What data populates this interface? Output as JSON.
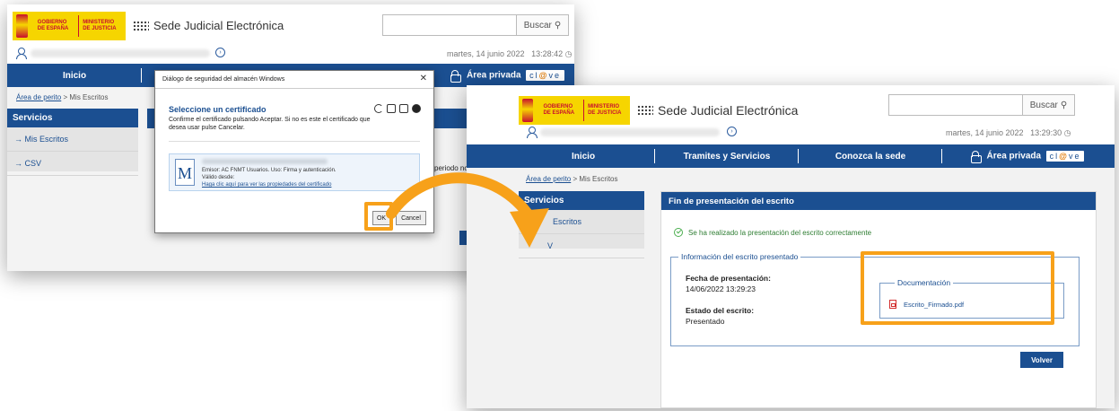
{
  "colors": {
    "brand_blue": "#1b4f91",
    "highlight_orange": "#f7a11a",
    "success_green": "#2e7d32",
    "pdf_red": "#d32f2f"
  },
  "left": {
    "header": {
      "gov_label": "GOBIERNO DE ESPAÑA",
      "ministry_label": "MINISTERIO DE JUSTICIA",
      "site_title": "Sede Judicial Electrónica",
      "search_button": "Buscar",
      "date": "martes, 14 junio 2022",
      "time": "13:28:42"
    },
    "nav": {
      "inicio": "Inicio",
      "area_privada": "Área privada",
      "clave_pre": "cl",
      "clave_mid": "@",
      "clave_post": "ve"
    },
    "breadcrumb": {
      "link": "Área de perito",
      "current": "Mis Escritos"
    },
    "sidebar": {
      "title": "Servicios",
      "items": [
        "→  Mis Escritos",
        "→  CSV"
      ]
    },
    "partial_text": "periodo no s",
    "dialog": {
      "title": "Diálogo de seguridad del almacén Windows",
      "heading": "Seleccione un certificado",
      "text": "Confirme el certificado pulsando Aceptar. Si no es este el certificado que desea usar pulse Cancelar.",
      "cert_issuer": "Emisor: AC FNMT Usuarios. Uso: Firma y autenticación.",
      "cert_valid": "Válido desde:",
      "cert_link": "Haga clic aquí para ver las propiedades del certificado",
      "ok": "OK",
      "cancel": "Cancel"
    }
  },
  "right": {
    "header": {
      "gov_label": "GOBIERNO DE ESPAÑA",
      "ministry_label": "MINISTERIO DE JUSTICIA",
      "site_title": "Sede Judicial Electrónica",
      "search_button": "Buscar",
      "date": "martes, 14 junio 2022",
      "time": "13:29:30"
    },
    "nav": {
      "inicio": "Inicio",
      "tramites": "Tramites y Servicios",
      "conozca": "Conozca la sede",
      "area_privada": "Área privada",
      "clave_pre": "cl",
      "clave_mid": "@",
      "clave_post": "ve"
    },
    "breadcrumb": {
      "link": "Área de perito",
      "current": "Mis Escritos"
    },
    "sidebar": {
      "title": "Servicios",
      "items": [
        "Escritos",
        "V"
      ]
    },
    "panel": {
      "title": "Fin de presentación del escrito",
      "success": "Se ha realizado la presentación del escrito correctamente",
      "info_legend": "Información del escrito presentado",
      "fecha_label": "Fecha de presentación:",
      "fecha_value": "14/06/2022 13:29:23",
      "estado_label": "Estado del escrito:",
      "estado_value": "Presentado",
      "doc_legend": "Documentación",
      "doc_file": "Escrito_Firmado.pdf",
      "volver": "Volver"
    }
  }
}
